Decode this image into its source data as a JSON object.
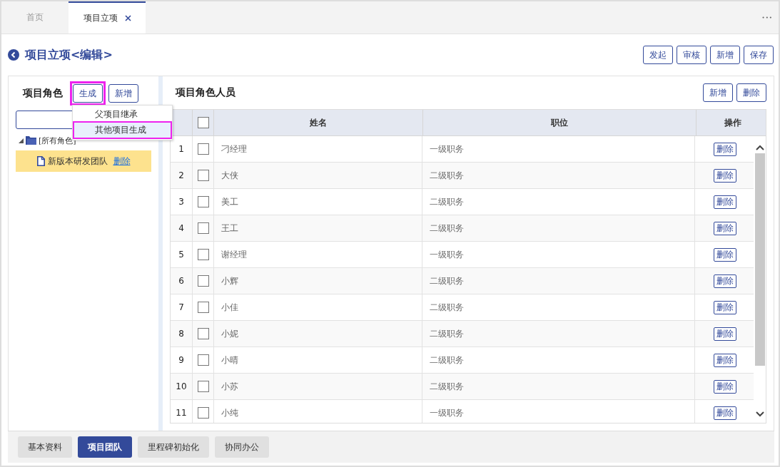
{
  "tabs": [
    {
      "label": "首页",
      "selected": false,
      "closable": false
    },
    {
      "label": "项目立项",
      "selected": true,
      "closable": true
    }
  ],
  "more_menu": "•••",
  "page_title": "项目立项<编辑>",
  "actions": [
    "发起",
    "审核",
    "新增",
    "保存"
  ],
  "roles_panel": {
    "title": "项目角色",
    "buttons": [
      {
        "label": "生成",
        "highlighted": true
      },
      {
        "label": "新增",
        "highlighted": false
      }
    ],
    "generate_menu": [
      {
        "label": "父项目继承",
        "selected": false,
        "highlighted": false
      },
      {
        "label": "其他项目生成",
        "selected": true,
        "highlighted": true
      }
    ],
    "tree": [
      {
        "label": "[所有角色]",
        "expanded": true,
        "children": [
          {
            "label": "新版本研发团队",
            "selected": true,
            "action": "删除"
          }
        ]
      }
    ]
  },
  "members_panel": {
    "title": "项目角色人员",
    "buttons": [
      "新增",
      "删除"
    ],
    "table": {
      "select_all_checked": false,
      "columns": [
        "姓名",
        "职位",
        "操作"
      ],
      "rows": [
        {
          "index": "1",
          "checked": false,
          "name": "刁经理",
          "position": "一级职务",
          "action": "删除"
        },
        {
          "index": "2",
          "checked": false,
          "name": "大侠",
          "position": "二级职务",
          "action": "删除"
        },
        {
          "index": "3",
          "checked": false,
          "name": "美工",
          "position": "二级职务",
          "action": "删除"
        },
        {
          "index": "4",
          "checked": false,
          "name": "王工",
          "position": "二级职务",
          "action": "删除"
        },
        {
          "index": "5",
          "checked": false,
          "name": "谢经理",
          "position": "一级职务",
          "action": "删除"
        },
        {
          "index": "6",
          "checked": false,
          "name": "小辉",
          "position": "二级职务",
          "action": "删除"
        },
        {
          "index": "7",
          "checked": false,
          "name": "小佳",
          "position": "二级职务",
          "action": "删除"
        },
        {
          "index": "8",
          "checked": false,
          "name": "小妮",
          "position": "二级职务",
          "action": "删除"
        },
        {
          "index": "9",
          "checked": false,
          "name": "小晴",
          "position": "二级职务",
          "action": "删除"
        },
        {
          "index": "10",
          "checked": false,
          "name": "小苏",
          "position": "二级职务",
          "action": "删除"
        },
        {
          "index": "11",
          "checked": false,
          "name": "小纯",
          "position": "一级职务",
          "action": "删除"
        }
      ]
    }
  },
  "bottom_tabs": [
    {
      "label": "基本资料",
      "selected": false
    },
    {
      "label": "项目团队",
      "selected": true
    },
    {
      "label": "里程碑初始化",
      "selected": false
    },
    {
      "label": "协同办公",
      "selected": false
    }
  ]
}
